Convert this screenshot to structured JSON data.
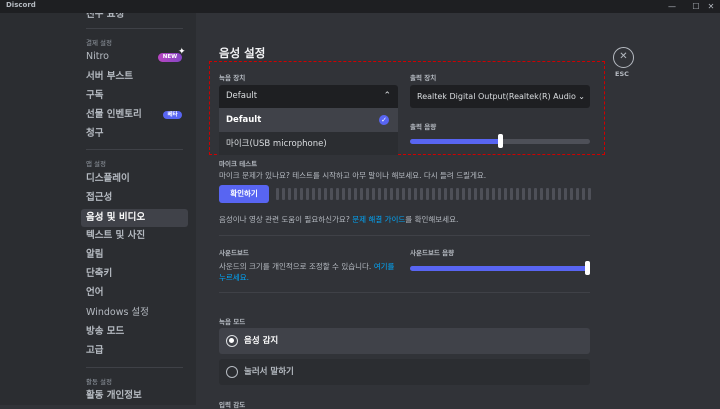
{
  "window": {
    "title": "Discord",
    "minimize": "—",
    "maximize": "☐",
    "close": "✕"
  },
  "sidebar": {
    "partial_top": "친구 요청",
    "sections": [
      {
        "header": "결제 설정",
        "items": [
          {
            "label": "Nitro",
            "badge": "NEW"
          },
          {
            "label": "서버 부스트"
          },
          {
            "label": "구독"
          },
          {
            "label": "선물 인벤토리",
            "badge": "베타"
          },
          {
            "label": "청구"
          }
        ]
      },
      {
        "header": "앱 설정",
        "items": [
          {
            "label": "디스플레이"
          },
          {
            "label": "접근성"
          },
          {
            "label": "음성 및 비디오",
            "selected": true
          },
          {
            "label": "텍스트 및 사진"
          },
          {
            "label": "알림"
          },
          {
            "label": "단축키"
          },
          {
            "label": "언어"
          },
          {
            "label": "Windows 설정"
          },
          {
            "label": "방송 모드"
          },
          {
            "label": "고급"
          }
        ]
      },
      {
        "header": "활동 설정",
        "items": [
          {
            "label": "활동 개인정보"
          }
        ]
      }
    ]
  },
  "main": {
    "title": "음성 설정",
    "close": {
      "icon": "close-icon",
      "label": "ESC"
    },
    "input_device": {
      "label": "녹음 장치",
      "value": "Default",
      "options": [
        "Default",
        "마이크(USB microphone)"
      ]
    },
    "output_device": {
      "label": "출력 장치",
      "value": "Realtek Digital Output(Realtek(R) Audio"
    },
    "output_volume": {
      "label": "출력 음량",
      "percent": 50
    },
    "mic_test": {
      "label": "마이크 테스트",
      "description": "마이크 문제가 있나요? 테스트를 시작하고 아무 말이나 해보세요. 다시 들려 드릴게요.",
      "button": "확인하기"
    },
    "help": {
      "before": "음성이나 영상 관련 도움이 필요하신가요? ",
      "link": "문제 해결 가이드",
      "after": "를 확인해보세요."
    },
    "soundboard": {
      "label": "사운드보드",
      "description": "사운드의 크기를 개인적으로 조정할 수 있습니다. ",
      "link_1": "여기를",
      "link_2": "누르세요.",
      "volume_label": "사운드보드 음량",
      "volume_percent": 100
    },
    "input_mode": {
      "label": "녹음 모드",
      "options": [
        {
          "label": "음성 감지",
          "selected": true
        },
        {
          "label": "눌러서 말하기",
          "selected": false
        }
      ]
    },
    "partial_bottom": "입력 감도"
  },
  "colors": {
    "accent": "#5865f2",
    "highlight_border": "#d00000",
    "link": "#00a8fc"
  }
}
